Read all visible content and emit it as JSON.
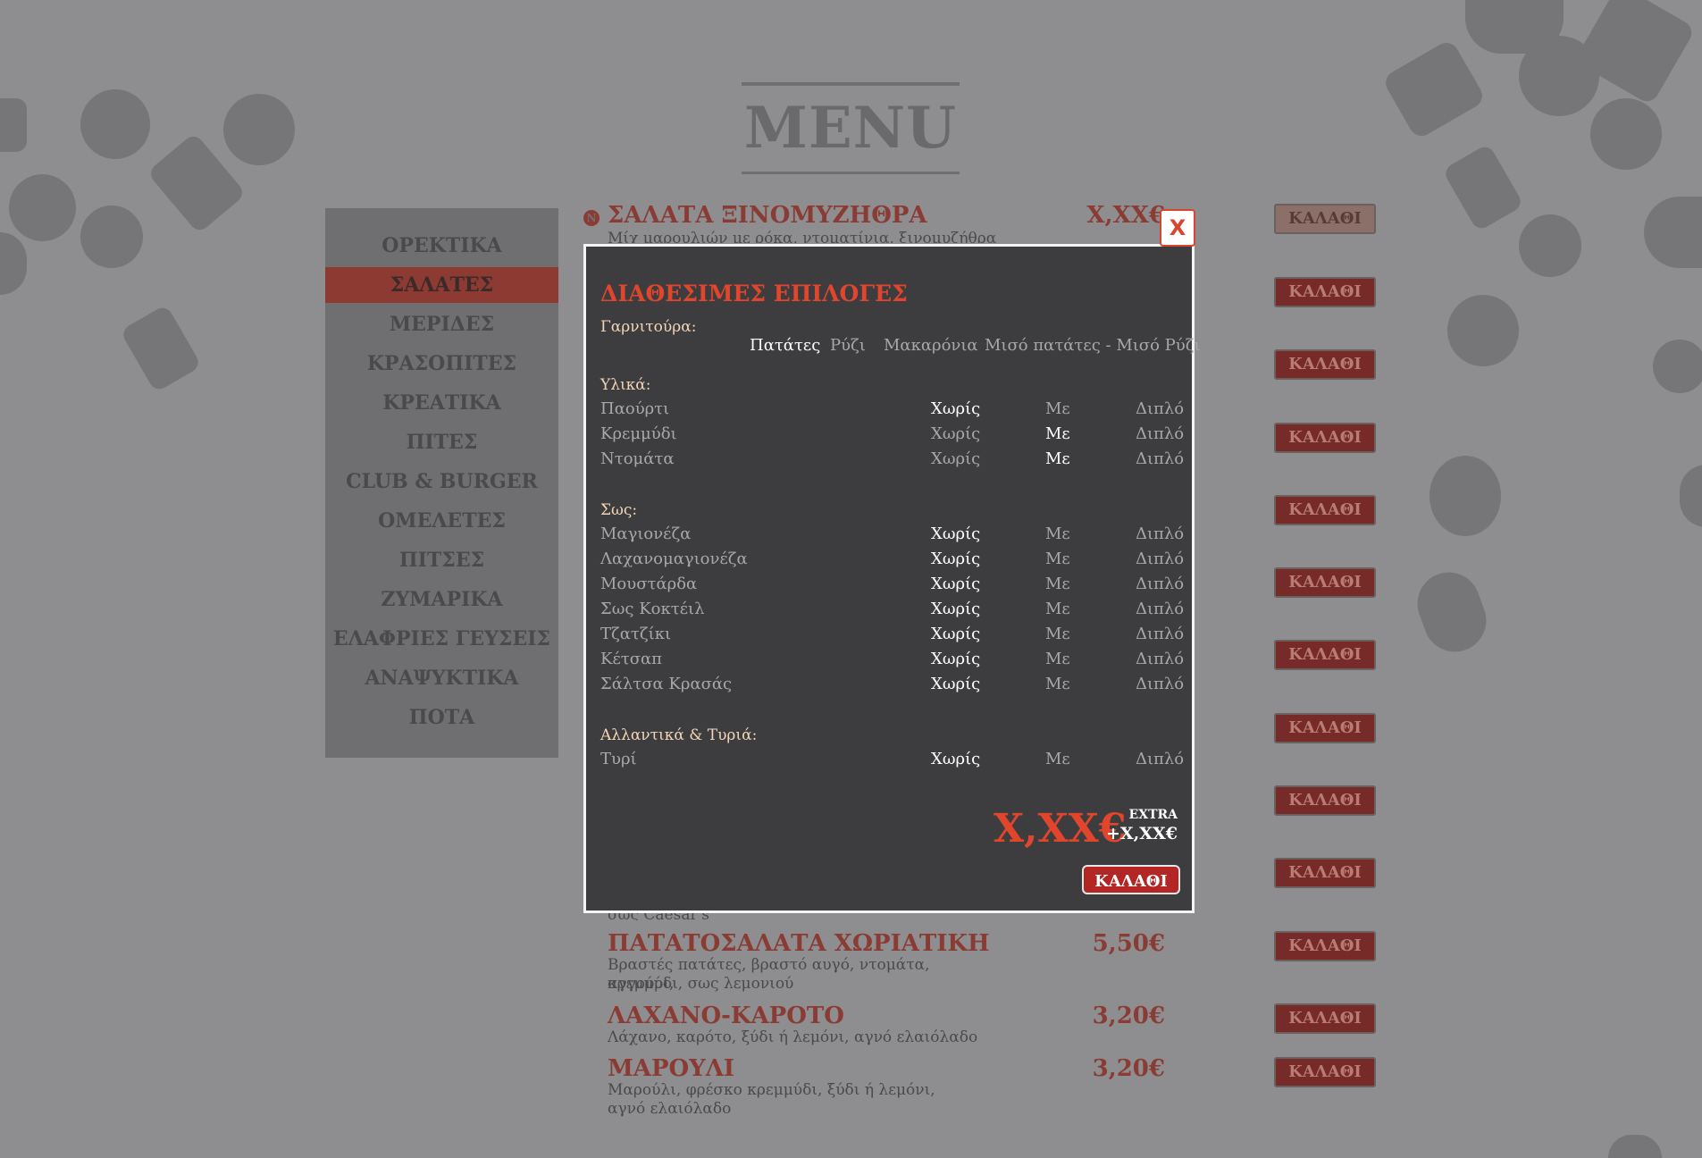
{
  "page_title": "MENU",
  "sidebar": {
    "items": [
      {
        "label": "ΟΡΕΚΤΙΚΑ"
      },
      {
        "label": "ΣΑΛΑΤΕΣ"
      },
      {
        "label": "ΜΕΡΙΔΕΣ"
      },
      {
        "label": "ΚΡΑΣΟΠΙΤΕΣ"
      },
      {
        "label": "ΚΡΕΑΤΙΚΑ"
      },
      {
        "label": "ΠΙΤΕΣ"
      },
      {
        "label": "CLUB & BURGER"
      },
      {
        "label": "ΟΜΕΛΕΤΕΣ"
      },
      {
        "label": "ΠΙΤΣΕΣ"
      },
      {
        "label": "ΖΥΜΑΡΙΚΑ"
      },
      {
        "label": "ΕΛΑΦΡΙΕΣ ΓΕΥΣΕΙΣ"
      },
      {
        "label": "ΑΝΑΨΥΚΤΙΚΑ"
      },
      {
        "label": "ΠΟΤΑ"
      }
    ],
    "active": "ΣΑΛΑΤΕΣ"
  },
  "menu_rows": {
    "first": {
      "title": "ΣΑΛΑΤΑ ΞΙΝΟΜΥΖΗΘΡΑ",
      "price": "X,XX€",
      "desc": "Μίχ μαρουλιών με ρόκα, ντοματίνια, ξινομυζήθρα",
      "veg_icon": "Ν"
    },
    "partial_desc": "σως Caesar's",
    "patatosalata": {
      "title": "ΠΑΤΑΤΟΣΑΛΑΤΑ ΧΩΡΙΑΤΙΚΗ",
      "price": "5,50€",
      "desc_1": "Βραστές πατάτες, βραστό αυγό, ντομάτα, αγγούρι,",
      "desc_2": "κρεμμύδι, σως λεμονιού"
    },
    "lahano": {
      "title": "ΛΑΧΑΝΟ-ΚΑΡΟΤΟ",
      "price": "3,20€",
      "desc": "Λάχανο, καρότο, ξύδι ή λεμόνι, αγνό ελαιόλαδο"
    },
    "marouli": {
      "title": "ΜΑΡΟΥΛΙ",
      "price": "3,20€",
      "desc_1": "Μαρούλι, φρέσκο κρεμμύδι, ξύδι ή λεμόνι,",
      "desc_2": "αγνό ελαιόλαδο"
    },
    "cart_label": "ΚΑΛΑΘΙ"
  },
  "modal": {
    "close_label": "X",
    "heading": "ΔΙΑΘΕΣΙΜΕΣ ΕΠΙΛΟΓΕΣ",
    "garnish": {
      "label": "Γαρνιτούρα:",
      "options": [
        "Πατάτες",
        "Ρύζι",
        "Μακαρόνια",
        "Μισό πατάτες - Μισό Ρύζι"
      ],
      "selected": "Πατάτες"
    },
    "sections": [
      {
        "label": "Υλικά:",
        "items": [
          {
            "name": "Παούρτι",
            "selected": "Χωρίς"
          },
          {
            "name": "Κρεμμύδι",
            "selected": "Με"
          },
          {
            "name": "Ντομάτα",
            "selected": "Με"
          }
        ]
      },
      {
        "label": "Σως:",
        "items": [
          {
            "name": "Μαγιονέζα",
            "selected": "Χωρίς"
          },
          {
            "name": "Λαχανομαγιονέζα",
            "selected": "Χωρίς"
          },
          {
            "name": "Μουστάρδα",
            "selected": "Χωρίς"
          },
          {
            "name": "Σως Κοκτέιλ",
            "selected": "Χωρίς"
          },
          {
            "name": "Τζατζίκι",
            "selected": "Χωρίς"
          },
          {
            "name": "Κέτσαπ",
            "selected": "Χωρίς"
          },
          {
            "name": "Σάλτσα Κρασάς",
            "selected": "Χωρίς"
          }
        ]
      },
      {
        "label": "Αλλαντικά & Τυριά:",
        "items": [
          {
            "name": "Τυρί",
            "selected": "Χωρίς"
          }
        ]
      }
    ],
    "choice_labels": {
      "without": "Χωρίς",
      "with": "Με",
      "double": "Διπλό"
    },
    "price": "X,XX€",
    "extra_label": "EXTRA",
    "extra_value": "+X,XX€",
    "cart_label": "ΚΑΛΑΘΙ"
  },
  "colors": {
    "accent": "#e1452c",
    "modal_bg": "#3d3d40",
    "page_bg": "#8e8e90",
    "muted_red": "#8a3b33"
  }
}
